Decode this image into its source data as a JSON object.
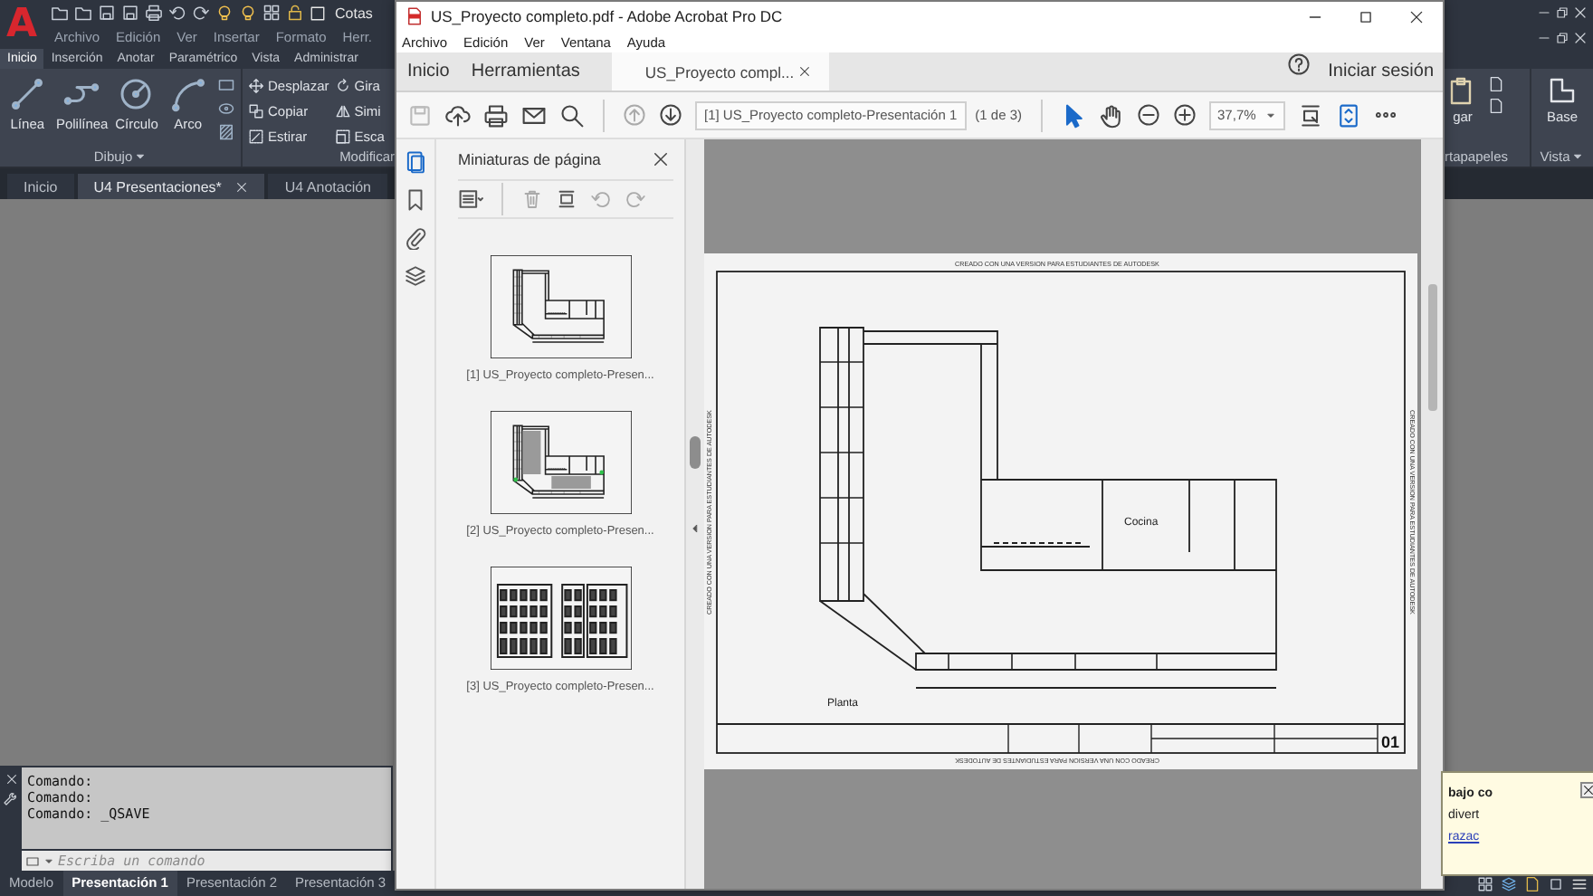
{
  "autocad": {
    "logo": "A",
    "layer_name": "Cotas",
    "menu": [
      "Archivo",
      "Edición",
      "Ver",
      "Insertar",
      "Formato",
      "Herr."
    ],
    "ribbon_tabs": [
      {
        "label": "Inicio",
        "selected": true
      },
      {
        "label": "Inserción",
        "selected": false
      },
      {
        "label": "Anotar",
        "selected": false
      },
      {
        "label": "Paramétrico",
        "selected": false
      },
      {
        "label": "Vista",
        "selected": false
      },
      {
        "label": "Administrar",
        "selected": false
      }
    ],
    "draw_tools": [
      {
        "label": "Línea",
        "kind": "line"
      },
      {
        "label": "Polilínea",
        "kind": "polyline"
      },
      {
        "label": "Círculo",
        "kind": "circle"
      },
      {
        "label": "Arco",
        "kind": "arc"
      }
    ],
    "draw_panel": "Dibujo",
    "modify_tools": [
      {
        "label": "Desplazar",
        "kind": "move"
      },
      {
        "label": "Copiar",
        "kind": "copy"
      },
      {
        "label": "Estirar",
        "kind": "stretch"
      },
      {
        "label": "Gira",
        "kind": "rotate"
      },
      {
        "label": "Simi",
        "kind": "mirror"
      },
      {
        "label": "Esca",
        "kind": "scale"
      }
    ],
    "modify_panel": "Modificar",
    "clipboard": {
      "tool": "gar",
      "panel": "rtapapeles"
    },
    "view": {
      "tool": "Base",
      "panel": "Vista"
    },
    "file_tabs": [
      {
        "label": "Inicio",
        "selected": false,
        "closable": false
      },
      {
        "label": "U4 Presentaciones*",
        "selected": true,
        "closable": true
      },
      {
        "label": "U4 Anotación",
        "selected": false,
        "closable": false
      }
    ],
    "command_history": [
      "Comando:",
      "Comando:",
      "Comando: _QSAVE"
    ],
    "command_input": {
      "placeholder": "Escriba un comando"
    },
    "layout_tabs": [
      {
        "label": "Modelo",
        "selected": false
      },
      {
        "label": "Presentación 1",
        "selected": true
      },
      {
        "label": "Presentación 2",
        "selected": false
      },
      {
        "label": "Presentación 3",
        "selected": false
      }
    ],
    "notification": {
      "title": "bajo co",
      "text": "divert",
      "link": "razac"
    }
  },
  "acrobat": {
    "title": "US_Proyecto completo.pdf - Adobe Acrobat Pro DC",
    "menu": [
      "Archivo",
      "Edición",
      "Ver",
      "Ventana",
      "Ayuda"
    ],
    "tabs": [
      {
        "label": "Inicio",
        "kind": "nav",
        "selected": false
      },
      {
        "label": "Herramientas",
        "kind": "nav",
        "selected": false
      },
      {
        "label": "US_Proyecto compl...",
        "kind": "document",
        "selected": true
      }
    ],
    "sign_in": "Iniciar sesión",
    "toolbar": {
      "save_disabled": true,
      "previous_disabled": true,
      "page_field": "[1] US_Proyecto completo-Presentación 1",
      "page_count": "(1 de 3)",
      "zoom": "37,7%"
    },
    "side_tools": [
      {
        "kind": "thumbnails",
        "selected": true
      },
      {
        "kind": "bookmarks",
        "selected": false
      },
      {
        "kind": "attachments",
        "selected": false
      },
      {
        "kind": "layers",
        "selected": false
      }
    ],
    "thumbnail_panel": {
      "title": "Miniaturas de página",
      "thumbnails": [
        {
          "kind": "plan",
          "caption": "[1] US_Proyecto completo-Presen..."
        },
        {
          "kind": "plan-furnished",
          "caption": "[2] US_Proyecto completo-Presen..."
        },
        {
          "kind": "elevation",
          "caption": "[3] US_Proyecto completo-Presen..."
        }
      ]
    },
    "page": {
      "stamps": [
        {
          "kind": "top",
          "text": "CREADO CON UNA VERSION PARA ESTUDIANTES DE AUTODESK"
        },
        {
          "kind": "left",
          "text": "CREADO CON UNA VERSION PARA ESTUDIANTES DE AUTODESK"
        },
        {
          "kind": "right",
          "text": "CREADO CON UNA VERSION PARA ESTUDIANTES DE AUTODESK"
        },
        {
          "kind": "bottom",
          "text": "CREADO CON UNA VERSION PARA ESTUDIANTES DE AUTODESK"
        }
      ],
      "room_label": "Cocina",
      "plan_label": "Planta",
      "sheet_number": "01"
    }
  }
}
